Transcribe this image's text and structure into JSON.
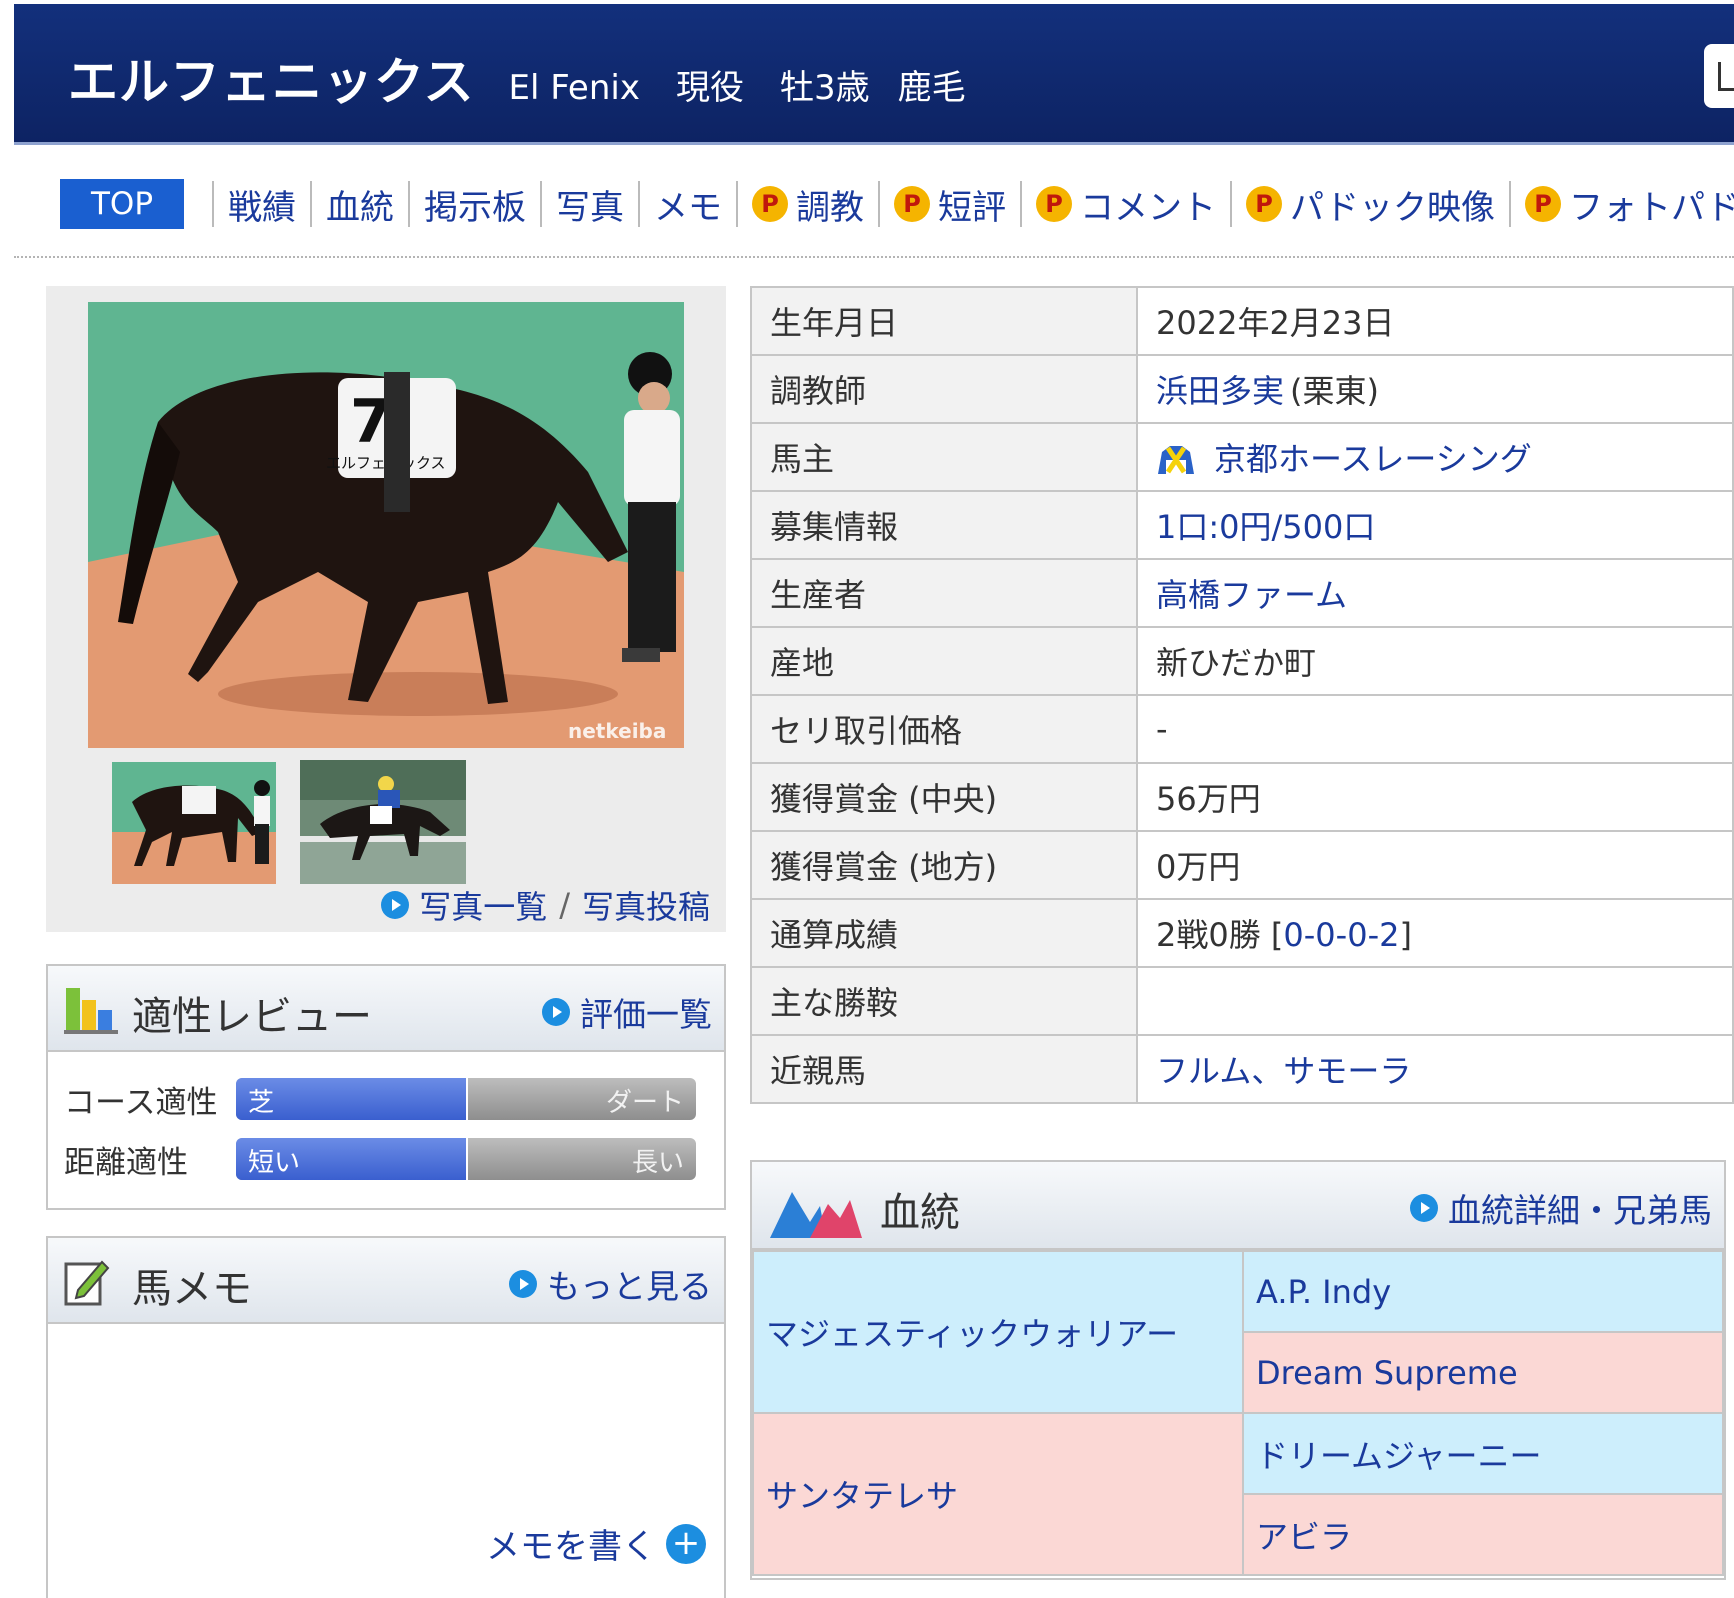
{
  "header": {
    "name": "エルフェニックス",
    "name_en": "El Fenix",
    "status": "現役",
    "sex_age": "牡3歳",
    "coat": "鹿毛"
  },
  "nav": {
    "top": "TOP",
    "items": [
      "戦績",
      "血統",
      "掲示板",
      "写真",
      "メモ"
    ],
    "premium_items": [
      "調教",
      "短評",
      "コメント",
      "パドック映像",
      "フォトパドック"
    ],
    "premium_badge": "P"
  },
  "photos": {
    "watermark": "netkeiba",
    "saddle_number": "7",
    "saddle_name": "エルフェニックス",
    "list_link": "写真一覧",
    "separator": "/",
    "post_link": "写真投稿"
  },
  "info": [
    {
      "label": "生年月日",
      "value": "2022年2月23日"
    },
    {
      "label": "調教師",
      "value": "浜田多実",
      "suffix": "(栗東)"
    },
    {
      "label": "馬主",
      "value": "京都ホースレーシング"
    },
    {
      "label": "募集情報",
      "value": "1口:0円/500口"
    },
    {
      "label": "生産者",
      "value": "高橋ファーム"
    },
    {
      "label": "産地",
      "value": "新ひだか町"
    },
    {
      "label": "セリ取引価格",
      "value": "-"
    },
    {
      "label": "獲得賞金 (中央)",
      "value": "56万円"
    },
    {
      "label": "獲得賞金 (地方)",
      "value": "0万円"
    },
    {
      "label": "通算成績",
      "value": "2戦0勝",
      "record_open": "[",
      "record": "0-0-0-2",
      "record_close": "]"
    },
    {
      "label": "主な勝鞍",
      "value": ""
    },
    {
      "label": "近親馬",
      "value": "フルム、サモーラ"
    }
  ],
  "review": {
    "title": "適性レビュー",
    "link": "評価一覧",
    "rows": [
      {
        "label": "コース適性",
        "left": "芝",
        "right": "ダート",
        "level": 0.5
      },
      {
        "label": "距離適性",
        "left": "短い",
        "right": "長い",
        "level": 0.5
      }
    ]
  },
  "memo": {
    "title": "馬メモ",
    "link": "もっと見る",
    "write": "メモを書く"
  },
  "pedigree": {
    "title": "血統",
    "link": "血統詳細・兄弟馬",
    "sire": "マジェスティックウォリアー",
    "sire_sire": "A.P. Indy",
    "sire_dam": "Dream Supreme",
    "dam": "サンタテレサ",
    "dam_sire": "ドリームジャーニー",
    "dam_dam": "アビラ"
  }
}
